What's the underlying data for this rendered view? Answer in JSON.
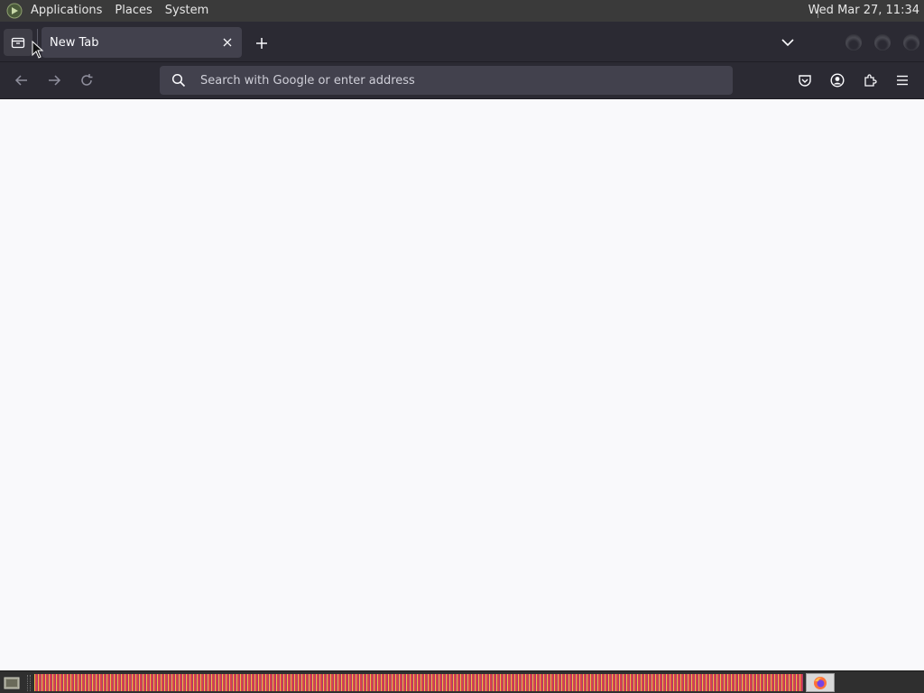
{
  "top_panel": {
    "menus": [
      "Applications",
      "Places",
      "System"
    ],
    "clock": "Wed Mar 27, 11:34",
    "logo_icon": "gnome-foot-icon"
  },
  "tab_strip": {
    "list_all_icon": "list-all-tabs-icon",
    "tabs": [
      {
        "label": "New Tab",
        "active": true
      }
    ],
    "new_tab_icon": "plus-icon",
    "overflow_icon": "chevron-down-icon",
    "window_buttons": [
      "minimize",
      "maximize",
      "close"
    ]
  },
  "nav_bar": {
    "back_icon": "back-arrow-icon",
    "forward_icon": "forward-arrow-icon",
    "reload_icon": "reload-icon",
    "urlbar": {
      "value": "",
      "placeholder": "Search with Google or enter address"
    },
    "toolbar_icons": [
      "pocket-icon",
      "account-icon",
      "extensions-icon",
      "hamburger-menu-icon"
    ]
  },
  "bottom_panel": {
    "active_task_icon": "firefox-icon"
  },
  "colors": {
    "chrome_bg": "#2b2a33",
    "tab_active_bg": "#42414d",
    "content_bg": "#f9f9fb",
    "panel_bg": "#3a3a3a"
  }
}
